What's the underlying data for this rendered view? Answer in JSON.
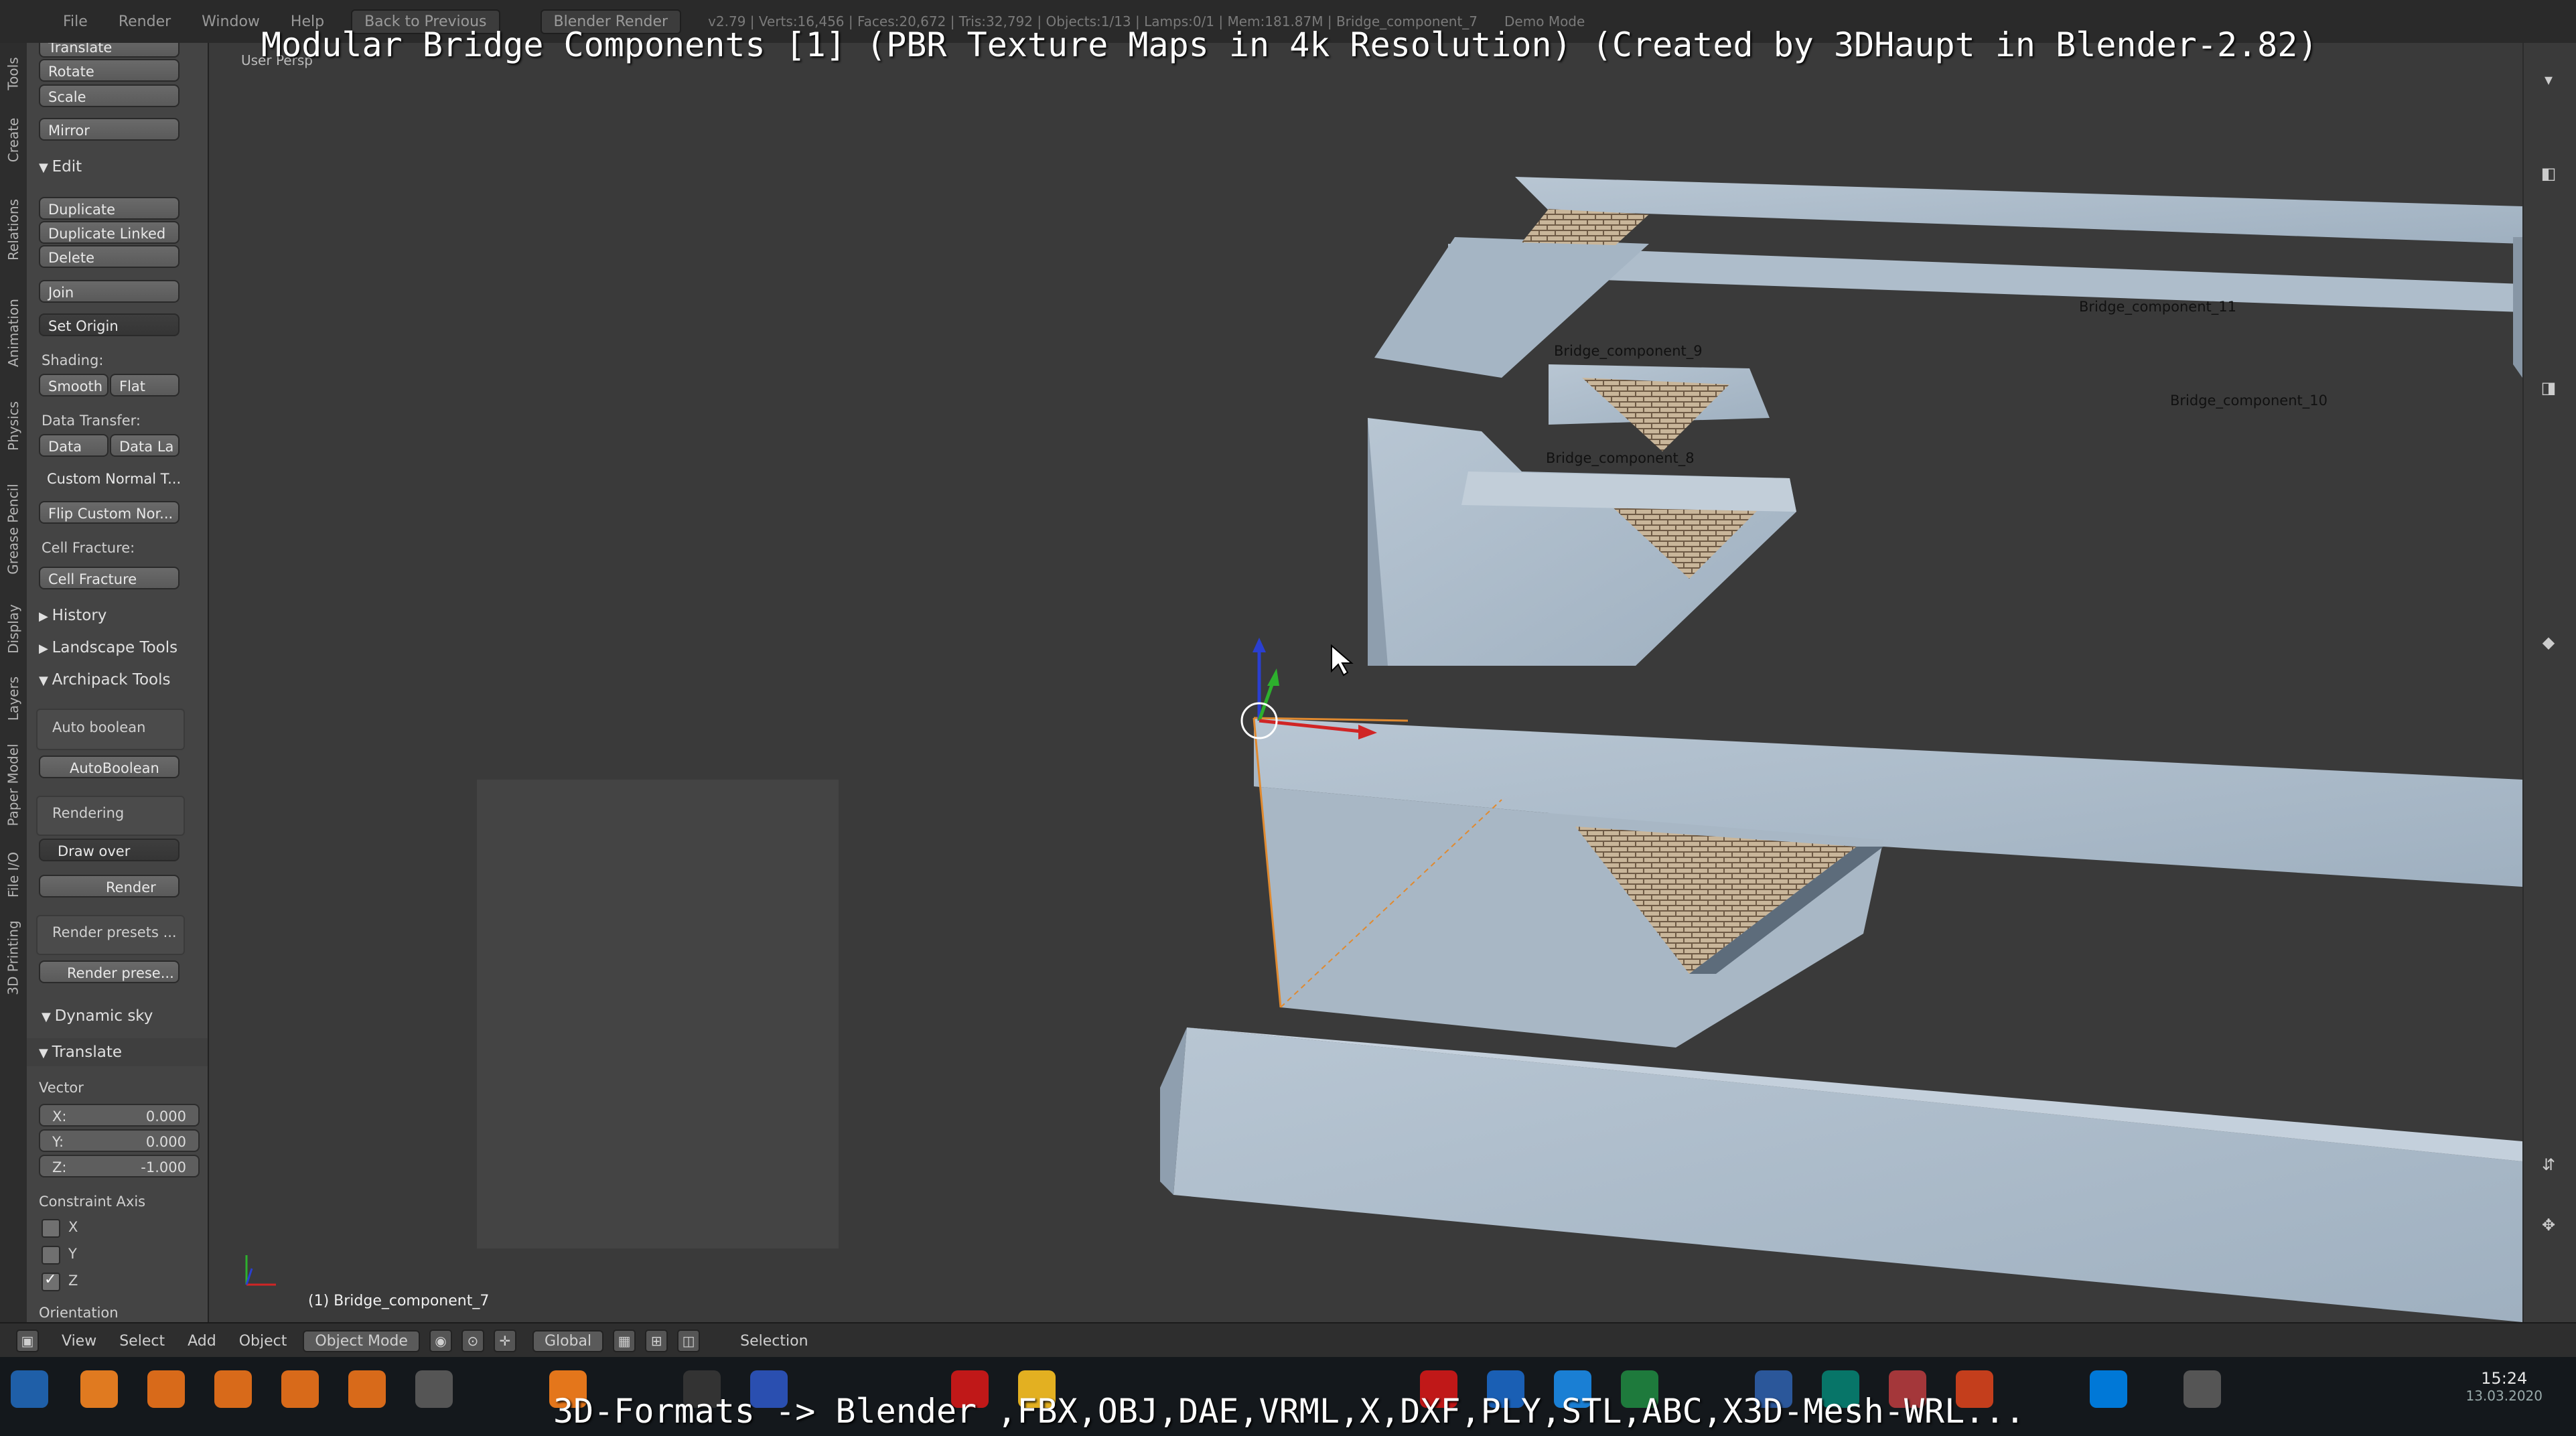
{
  "window": {
    "title_overlay": "Modular Bridge Components [1] (PBR Texture Maps in 4k Resolution) (Created by 3DHaupt in Blender-2.82)",
    "subtitle_overlay": "3D-Formats -> Blender ,FBX,OBJ,DAE,VRML,X,DXF,PLY,STL,ABC,X3D-Mesh-WRL..."
  },
  "topbar": {
    "menus": [
      "File",
      "Render",
      "Window",
      "Help"
    ],
    "back_label": "Back to Previous",
    "engine": "Blender Render",
    "info": "v2.79 | Verts:16,456 | Faces:20,672 | Tris:32,792 | Objects:1/13 | Lamps:0/1 | Mem:181.87M | Bridge_component_7",
    "demo_mode": "Demo Mode"
  },
  "tabs": [
    "Tools",
    "Create",
    "Relations",
    "Animation",
    "Physics",
    "Grease Pencil",
    "Display",
    "Layers",
    "Paper Model",
    "File I/O",
    "3D Printing"
  ],
  "shelf": {
    "top_partial": "Translate",
    "rotate": "Rotate",
    "scale": "Scale",
    "mirror": "Mirror",
    "edit_header": "Edit",
    "duplicate": "Duplicate",
    "duplicate_linked": "Duplicate Linked",
    "delete": "Delete",
    "join": "Join",
    "set_origin": "Set Origin",
    "shading_label": "Shading:",
    "smooth": "Smooth",
    "flat": "Flat",
    "data_transfer_label": "Data Transfer:",
    "data": "Data",
    "data_la": "Data La",
    "custom_normal": "Custom Normal T...",
    "flip_custom": "Flip Custom Nor...",
    "cell_fracture_label": "Cell Fracture:",
    "cell_fracture": "Cell Fracture",
    "history": "History",
    "landscape": "Landscape Tools",
    "archipack": "Archipack Tools",
    "auto_boolean_label": "Auto boolean",
    "autoboolean": "AutoBoolean",
    "rendering_label": "Rendering",
    "draw_over": "Draw over",
    "render": "Render",
    "render_presets_label": "Render presets ...",
    "render_presets_btn": "Render prese...",
    "dynamic_sky": "Dynamic sky"
  },
  "operator": {
    "header": "Translate",
    "vector_label": "Vector",
    "x_label": "X:",
    "x_value": "0.000",
    "y_label": "Y:",
    "y_value": "0.000",
    "z_label": "Z:",
    "z_value": "-1.000",
    "constraint_label": "Constraint Axis",
    "cx": "X",
    "cy": "Y",
    "cz": "Z",
    "orientation_label": "Orientation"
  },
  "viewport": {
    "persp_label": "User Persp",
    "active_object": "(1) Bridge_component_7",
    "labels": [
      "Bridge_component_11",
      "Bridge_component_10",
      "Bridge_component_9",
      "Bridge_component_8"
    ]
  },
  "bottom_header": {
    "menus": [
      "View",
      "Select",
      "Add",
      "Object"
    ],
    "mode": "Object Mode",
    "orientation": "Global",
    "status": "Selection"
  },
  "taskbar": {
    "time": "15:24",
    "date": "13.03.2020"
  }
}
